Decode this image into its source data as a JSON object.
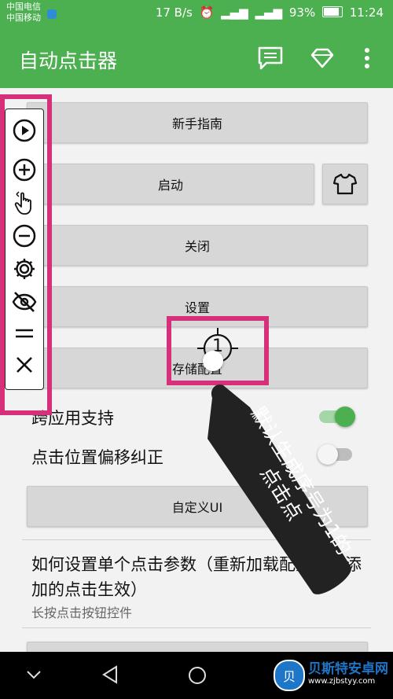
{
  "status": {
    "carrier1": "中国电信",
    "carrier2": "中国移动",
    "speed": "17 B/s",
    "battery_pct": "93%",
    "time": "11:24"
  },
  "app": {
    "title": "自动点击器"
  },
  "buttons": {
    "guide": "新手指南",
    "start": "启动",
    "close": "关闭",
    "settings": "设置",
    "save_config": "存储配置",
    "custom_ui": "自定义UI"
  },
  "toggles": {
    "cross_app": {
      "label": "跨应用支持",
      "on": true
    },
    "offset": {
      "label": "点击位置偏移纠正",
      "on": false
    }
  },
  "pref": {
    "title": "如何设置单个点击参数（重新加载配置或新添加的点击生效）",
    "subtitle": "长按点击按钮控件"
  },
  "target": {
    "number": "1"
  },
  "annotation": {
    "text": "默认生成序号为1的点击点"
  },
  "watermark": {
    "name": "贝斯特安卓网",
    "url": "www.zjbstyy.com",
    "logo": "贝"
  },
  "colors": {
    "accent": "#4caf50",
    "highlight": "#d6307a",
    "callout": "#222222"
  }
}
